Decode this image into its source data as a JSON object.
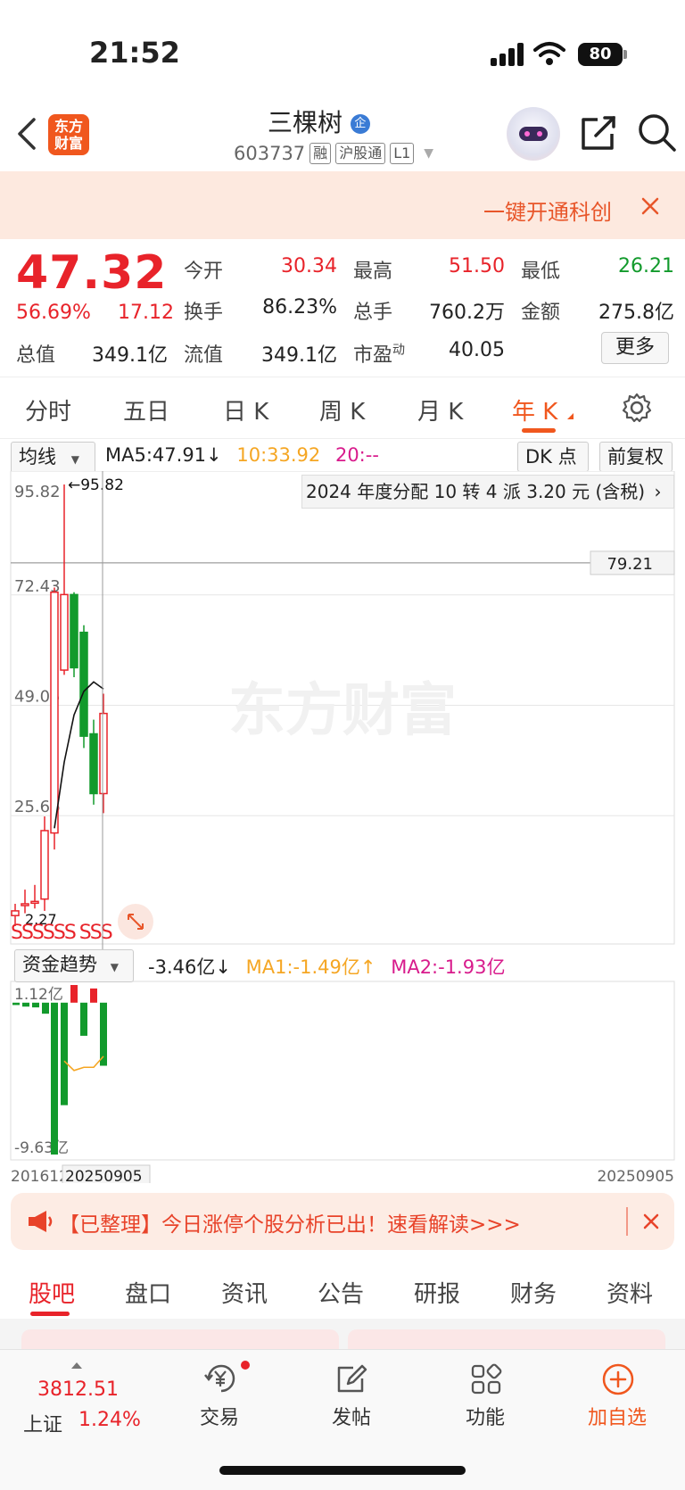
{
  "status": {
    "time": "21:52",
    "battery": "80"
  },
  "header": {
    "logo_text": "东方财富",
    "stock_name": "三棵树",
    "name_badge": "企",
    "stock_code": "603737",
    "tags": [
      "融",
      "沪股通",
      "L1"
    ]
  },
  "promo": {
    "text": "一键开通科创板"
  },
  "quote": {
    "price": "47.32",
    "change_pct": "56.69%",
    "change": "17.12",
    "market_cap_label": "总值",
    "market_cap": "349.1亿",
    "rows": [
      [
        {
          "label": "今开",
          "value": "30.34",
          "color": "#e8232a"
        },
        {
          "label": "最高",
          "value": "51.50",
          "color": "#e8232a"
        },
        {
          "label": "最低",
          "value": "26.21",
          "color": "#129a2c"
        }
      ],
      [
        {
          "label": "换手",
          "value": "86.23%",
          "color": "#222"
        },
        {
          "label": "总手",
          "value": "760.2万",
          "color": "#222"
        },
        {
          "label": "金额",
          "value": "275.8亿",
          "color": "#222"
        }
      ],
      [
        {
          "label": "流值",
          "value": "349.1亿",
          "color": "#222"
        },
        {
          "label": "市盈",
          "value": "40.05",
          "color": "#222"
        }
      ]
    ],
    "pe_superscript": "动",
    "more_label": "更多"
  },
  "period_tabs": [
    "分时",
    "五日",
    "日 K",
    "周 K",
    "月 K",
    "年 K"
  ],
  "chart_header": {
    "indicator_select": "均线",
    "ma5": "MA5:47.91",
    "ma10": "10:33.92",
    "ma20": "20:--",
    "dk_label": "DK 点",
    "adjust_label": "前复权",
    "dividend_note": "2024 年度分配 10 转 4 派 3.20 元 (含税)"
  },
  "chart_data": [
    {
      "type": "candlestick",
      "title": "",
      "y_ticks": [
        "95.82",
        "72.43",
        "49.05",
        "25.66"
      ],
      "ylim": [
        2.27,
        95.82
      ],
      "high_marker": "95.82",
      "low_marker": "2.27",
      "crosshair_price": "79.21",
      "x_start_label": "201612",
      "x_cursor_label": "20250905",
      "x_end_label": "20250905",
      "watermark": "东方财富",
      "candles": [
        {
          "o": 4.5,
          "h": 7.0,
          "l": 2.27,
          "c": 5.5
        },
        {
          "o": 7.0,
          "h": 10.0,
          "l": 5.0,
          "c": 7.0
        },
        {
          "o": 7.5,
          "h": 11.0,
          "l": 6.0,
          "c": 7.5
        },
        {
          "o": 8.0,
          "h": 25.5,
          "l": 5.5,
          "c": 22.5
        },
        {
          "o": 22.0,
          "h": 74.0,
          "l": 18.5,
          "c": 73.0
        },
        {
          "o": 56.5,
          "h": 95.82,
          "l": 55.5,
          "c": 72.5
        },
        {
          "o": 72.5,
          "h": 73.0,
          "l": 55.0,
          "c": 57.0
        },
        {
          "o": 64.5,
          "h": 66.0,
          "l": 40.0,
          "c": 42.5
        },
        {
          "o": 43.0,
          "h": 46.0,
          "l": 28.0,
          "c": 30.34
        },
        {
          "o": 30.34,
          "h": 51.5,
          "l": 26.21,
          "c": 47.32
        }
      ],
      "ma5_line": [
        null,
        null,
        null,
        null,
        23.0,
        37.0,
        47.0,
        52.0,
        54.0,
        52.5
      ],
      "sss_marks": "SSSSSS SSS"
    },
    {
      "type": "bar",
      "title": "资金趋势",
      "value_label": "-3.46亿",
      "ma1": "MA1:-1.49亿",
      "ma2": "MA2:-1.93亿",
      "y_ticks": [
        "1.12亿",
        "-9.63亿"
      ],
      "ylim": [
        -9.63,
        1.12
      ],
      "values": [
        -0.15,
        -0.25,
        -0.3,
        -0.7,
        -9.63,
        -6.5,
        1.12,
        -2.1,
        0.9,
        -4.0
      ],
      "ma1_line": [
        null,
        null,
        null,
        null,
        null,
        -3.7,
        -4.3,
        -4.1,
        -4.1,
        -3.4
      ]
    }
  ],
  "notice": {
    "text": "【已整理】今日涨停个股分析已出！速看解读>>>"
  },
  "bottom_tabs": [
    "股吧",
    "盘口",
    "资讯",
    "公告",
    "研报",
    "财务",
    "资料"
  ],
  "dock": {
    "index_value": "3812.51",
    "index_name": "上证",
    "index_change": "1.24%",
    "items": [
      "交易",
      "发帖",
      "功能",
      "加自选"
    ]
  }
}
